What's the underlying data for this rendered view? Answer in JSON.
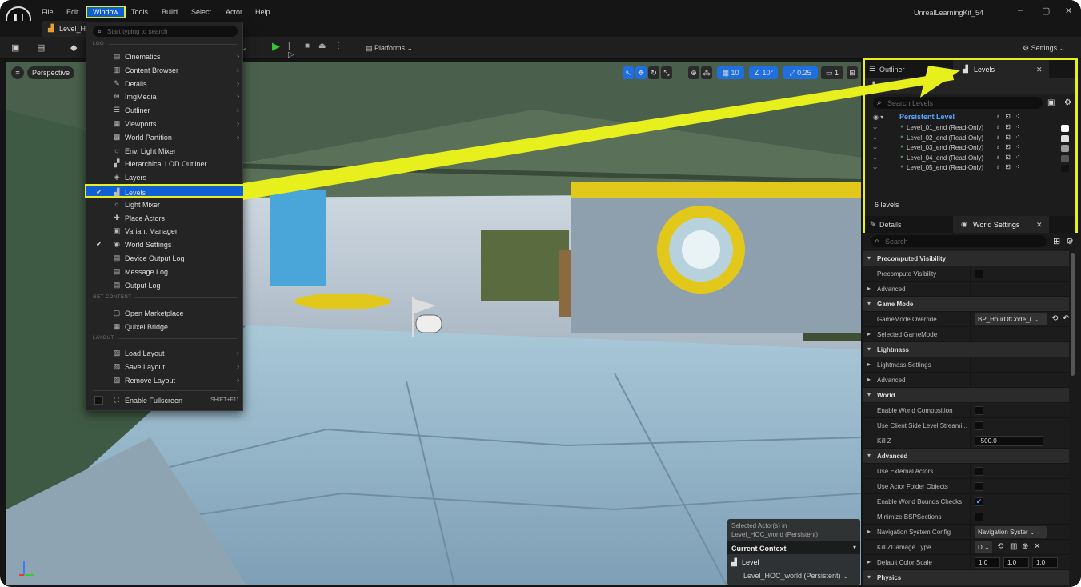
{
  "menubar": {
    "logo": "U",
    "items": [
      "File",
      "Edit",
      "Window",
      "Tools",
      "Build",
      "Select",
      "Actor",
      "Help"
    ],
    "active": "Window",
    "app_title": "UnrealLearningKit_54",
    "minimize": "–",
    "maximize": "▢",
    "close": "✕"
  },
  "tab": {
    "label": "Level_H",
    "icon": "level-icon"
  },
  "toolbar": {
    "platforms": "Platforms",
    "settings": "Settings"
  },
  "viewport": {
    "perspective": "Perspective",
    "grid_snap": "10",
    "rotation_snap": "10°",
    "scale_snap": "0.25",
    "camera_speed": "1",
    "context": {
      "selected_line1": "Selected Actor(s) in",
      "selected_line2": "Level_HOC_world (Persistent)",
      "current_context": "Current Context",
      "level_label": "Level",
      "level_value": "Level_HOC_world (Persistent)"
    }
  },
  "window_menu": {
    "search_placeholder": "Start typing to search",
    "sections": {
      "log": "LOG",
      "get_content": "GET CONTENT",
      "layout": "LAYOUT"
    },
    "items": [
      {
        "label": "Cinematics",
        "icon": "clapper-icon",
        "arrow": true,
        "checked": false
      },
      {
        "label": "Content Browser",
        "icon": "folder-icon",
        "arrow": true,
        "checked": false
      },
      {
        "label": "Details",
        "icon": "pencil-icon",
        "arrow": true,
        "checked": false
      },
      {
        "label": "ImgMedia",
        "icon": "media-icon",
        "arrow": true,
        "checked": false
      },
      {
        "label": "Outliner",
        "icon": "outliner-icon",
        "arrow": true,
        "checked": false
      },
      {
        "label": "Viewports",
        "icon": "viewports-icon",
        "arrow": true,
        "checked": false
      },
      {
        "label": "World Partition",
        "icon": "partition-icon",
        "arrow": true,
        "checked": false
      },
      {
        "label": "Env. Light Mixer",
        "icon": "light-mixer-icon",
        "arrow": false,
        "checked": false
      },
      {
        "label": "Hierarchical LOD Outliner",
        "icon": "lod-icon",
        "arrow": false,
        "checked": false
      },
      {
        "label": "Layers",
        "icon": "layers-icon",
        "arrow": false,
        "checked": false
      },
      {
        "label": "Levels",
        "icon": "levels-icon",
        "arrow": false,
        "checked": true
      },
      {
        "label": "Light Mixer",
        "icon": "light-mixer-icon",
        "arrow": false,
        "checked": false
      },
      {
        "label": "Place Actors",
        "icon": "place-actors-icon",
        "arrow": false,
        "checked": false
      },
      {
        "label": "Variant Manager",
        "icon": "variant-icon",
        "arrow": false,
        "checked": false
      },
      {
        "label": "World Settings",
        "icon": "globe-icon",
        "arrow": false,
        "checked": true
      },
      {
        "label": "Device Output Log",
        "icon": "log-icon",
        "arrow": false,
        "checked": false
      },
      {
        "label": "Message Log",
        "icon": "log-icon",
        "arrow": false,
        "checked": false
      },
      {
        "label": "Output Log",
        "icon": "log-icon",
        "arrow": false,
        "checked": false
      }
    ],
    "content_items": [
      {
        "label": "Open Marketplace",
        "icon": "marketplace-icon"
      },
      {
        "label": "Quixel Bridge",
        "icon": "bridge-icon"
      }
    ],
    "layout_items": [
      {
        "label": "Load Layout",
        "icon": "layout-icon"
      },
      {
        "label": "Save Layout",
        "icon": "layout-icon"
      },
      {
        "label": "Remove Layout",
        "icon": "layout-icon"
      }
    ],
    "fullscreen": {
      "label": "Enable Fullscreen",
      "shortcut": "SHIFT+F11"
    }
  },
  "levels_panel": {
    "tab_outliner": "Outliner",
    "tab_levels": "Levels",
    "toolbar_label": "Levels",
    "search_placeholder": "Search Levels",
    "persistent": "Persistent Level",
    "levels": [
      {
        "name": "Level_01_end (Read-Only)",
        "color": "#ffffff"
      },
      {
        "name": "Level_02_end (Read-Only)",
        "color": "#dedede"
      },
      {
        "name": "Level_03_end (Read-Only)",
        "color": "#9a9a9a"
      },
      {
        "name": "Level_04_end (Read-Only)",
        "color": "#555555"
      },
      {
        "name": "Level_05_end (Read-Only)",
        "color": "#111111"
      }
    ],
    "count": "6 levels",
    "tab_details": "Details",
    "tab_world": "World Settings"
  },
  "details": {
    "search_placeholder": "Search",
    "rows": [
      {
        "type": "cat",
        "label": "Precomputed Visibility",
        "open": true
      },
      {
        "type": "prop",
        "label": "Precompute Visibility",
        "check": false
      },
      {
        "type": "sub",
        "label": "Advanced",
        "open": false
      },
      {
        "type": "cat",
        "label": "Game Mode",
        "open": true
      },
      {
        "type": "prop",
        "label": "GameMode Override",
        "combo": "BP_HourOfCode_("
      },
      {
        "type": "sub",
        "label": "Selected GameMode",
        "open": false
      },
      {
        "type": "cat",
        "label": "Lightmass",
        "open": true
      },
      {
        "type": "sub",
        "label": "Lightmass Settings",
        "open": false
      },
      {
        "type": "sub",
        "label": "Advanced",
        "open": false
      },
      {
        "type": "cat",
        "label": "World",
        "open": true
      },
      {
        "type": "prop",
        "label": "Enable World Composition",
        "check": false
      },
      {
        "type": "prop",
        "label": "Use Client Side Level Streami...",
        "check": false
      },
      {
        "type": "prop",
        "label": "Kill Z",
        "value": "-500.0"
      },
      {
        "type": "cat2",
        "label": "Advanced",
        "open": true
      },
      {
        "type": "prop",
        "label": "Use External Actors",
        "check": false
      },
      {
        "type": "prop",
        "label": "Use Actor Folder Objects",
        "check": false
      },
      {
        "type": "prop",
        "label": "Enable World Bounds Checks",
        "check": true
      },
      {
        "type": "prop",
        "label": "Minimize BSPSections",
        "check": false
      },
      {
        "type": "sub",
        "label": "Navigation System Config",
        "open": false,
        "combo": "Navigation Syster"
      },
      {
        "type": "prop",
        "label": "Kill ZDamage Type",
        "combo": "D"
      },
      {
        "type": "sub",
        "label": "Default Color Scale",
        "open": false,
        "triple": [
          "1.0",
          "1.0",
          "1.0"
        ]
      },
      {
        "type": "cat",
        "label": "Physics",
        "open": true
      }
    ]
  }
}
